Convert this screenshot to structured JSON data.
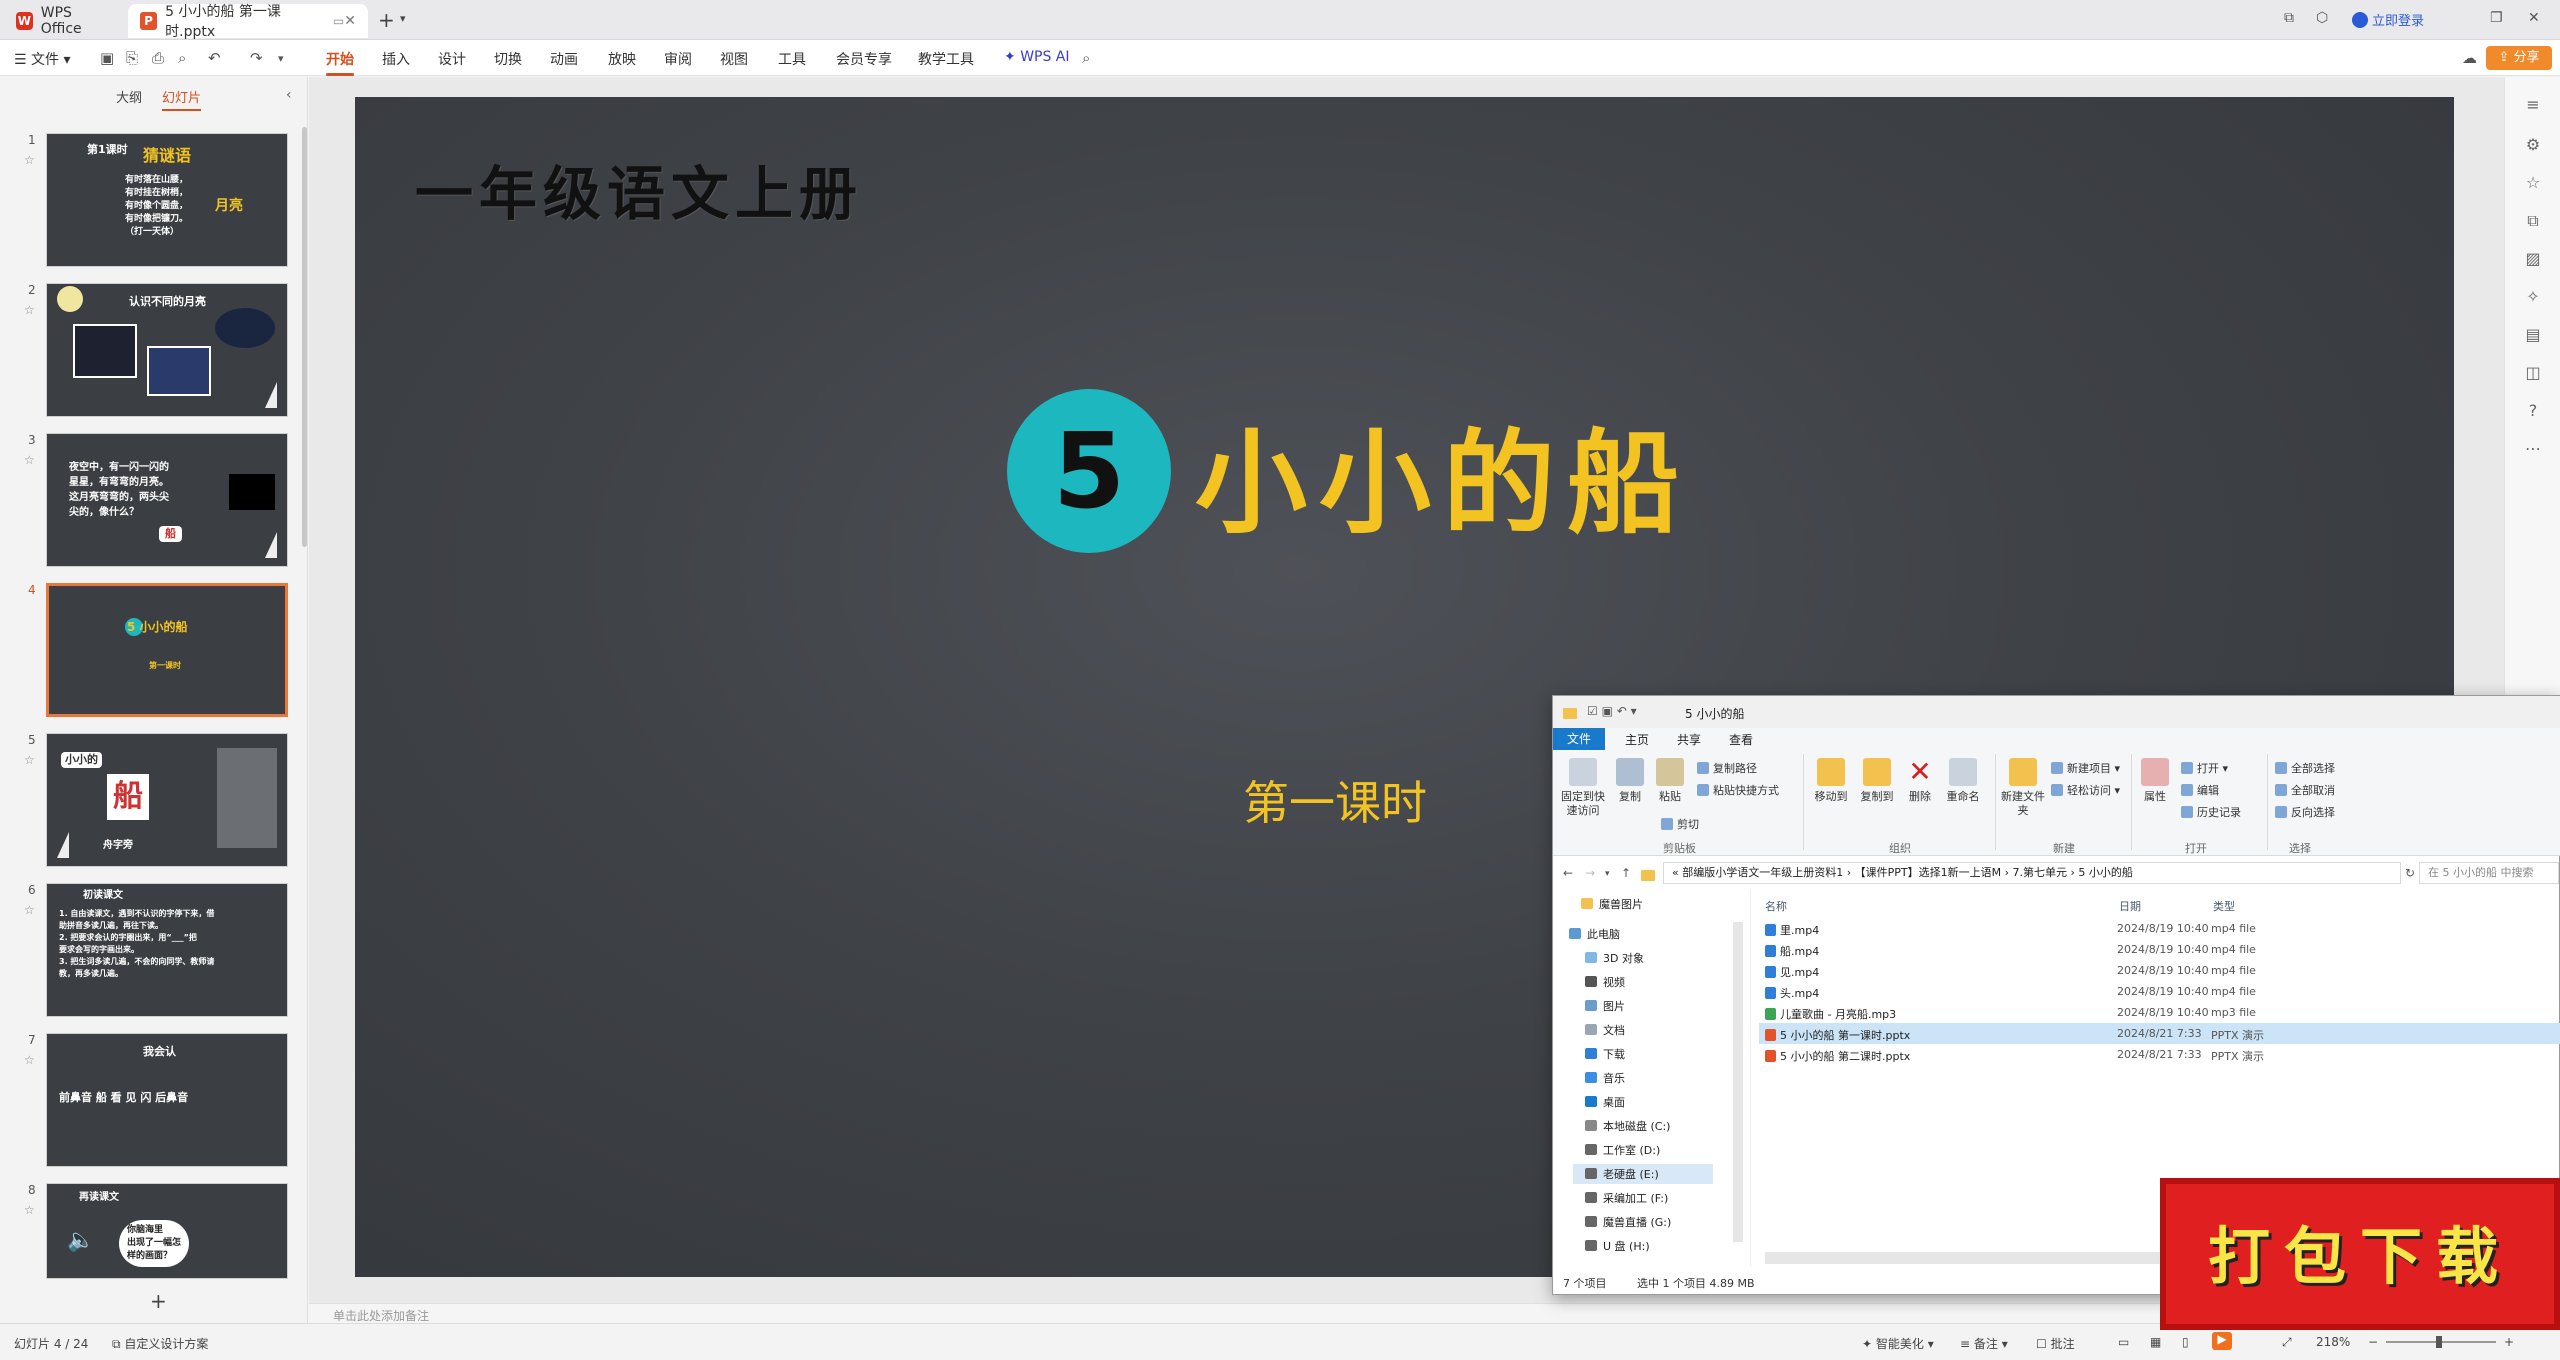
{
  "titlebar": {
    "home_tab": "WPS Office",
    "doc_tab": "5 小小的船 第一课时.pptx",
    "login": "立即登录"
  },
  "menubar": {
    "file": "文件",
    "items": [
      "开始",
      "插入",
      "设计",
      "切换",
      "动画",
      "放映",
      "审阅",
      "视图",
      "工具",
      "会员专享",
      "教学工具"
    ],
    "wps_ai": "WPS AI",
    "share": "分享"
  },
  "left_panel": {
    "tab_outline": "大纲",
    "tab_slides": "幻灯片",
    "slides": [
      {
        "num": "1",
        "text": "第1课时",
        "title": "猜谜语",
        "body": "有时落在山腰，\n有时挂在树梢，\n有时像个圆盘，\n有时像把镰刀。\n（打一天体）",
        "answer": "月亮"
      },
      {
        "num": "2",
        "title": "认识不同的月亮"
      },
      {
        "num": "3",
        "body": "夜空中，有一闪一闪的\n星星，有弯弯的月亮。\n这月亮弯弯的，两头尖\n尖的，像什么？",
        "answer": "船"
      },
      {
        "num": "4",
        "title": "5 小小的船",
        "body": "第一课时"
      },
      {
        "num": "5",
        "text": "小小的",
        "answer": "船",
        "body": "舟字旁"
      },
      {
        "num": "6",
        "title": "初读课文",
        "body": "1. 自由读课文，遇到不认识的字停下来，借\n助拼音多读几遍，再往下读。\n2. 把要求会认的字圈出来，用“___”把\n要求会写的字画出来。\n3. 把生词多读几遍，不会的向同学、教师请\n教，再多读几遍。"
      },
      {
        "num": "7",
        "title": "我会认",
        "body": "前鼻音   船  看  见  闪   后鼻音"
      },
      {
        "num": "8",
        "title": "再读课文",
        "body": "你脑海里\n出现了一幅怎\n样的画面？"
      }
    ]
  },
  "slide": {
    "grade": "一年级语文上册",
    "lesson_num": "5",
    "title": "小小的船",
    "subtitle": "第一课时"
  },
  "notes_placeholder": "单击此处添加备注",
  "statusbar": {
    "slide_count": "幻灯片 4 / 24",
    "design": "自定义设计方案",
    "beautify": "智能美化",
    "notes": "备注",
    "comments": "批注",
    "zoom": "218%"
  },
  "explorer": {
    "title": "5 小小的船",
    "tabs": [
      "文件",
      "主页",
      "共享",
      "查看"
    ],
    "ribbon": {
      "pin": "固定到快速访问",
      "copy": "复制",
      "paste": "粘贴",
      "copy_path": "复制路径",
      "paste_shortcut": "粘贴快捷方式",
      "cut": "剪切",
      "clipboard_group": "剪贴板",
      "move_to": "移动到",
      "copy_to": "复制到",
      "delete": "删除",
      "rename": "重命名",
      "organize_group": "组织",
      "new_folder": "新建文件夹",
      "new_item": "新建项目",
      "easy_access": "轻松访问",
      "new_group": "新建",
      "properties": "属性",
      "open": "打开",
      "edit": "编辑",
      "history": "历史记录",
      "open_group": "打开",
      "select_all": "全部选择",
      "select_none": "全部取消",
      "invert": "反向选择",
      "select_group": "选择"
    },
    "address": "« 部编版小学语文一年级上册资料1 › 【课件PPT】选择1新一上语M › 7.第七单元 › 5 小小的船",
    "search_placeholder": "在 5 小小的船 中搜索",
    "nav": [
      "魔兽图片",
      "此电脑",
      "3D 对象",
      "视频",
      "图片",
      "文档",
      "下载",
      "音乐",
      "桌面",
      "本地磁盘 (C:)",
      "工作室 (D:)",
      "老硬盘 (E:)",
      "采编加工 (F:)",
      "魔兽直播 (G:)",
      "U 盘 (H:)"
    ],
    "columns": {
      "name": "名称",
      "date": "日期",
      "type": "类型"
    },
    "files": [
      {
        "name": "里.mp4",
        "date": "2024/8/19 10:40",
        "type": "mp4 file"
      },
      {
        "name": "船.mp4",
        "date": "2024/8/19 10:40",
        "type": "mp4 file"
      },
      {
        "name": "见.mp4",
        "date": "2024/8/19 10:40",
        "type": "mp4 file"
      },
      {
        "name": "头.mp4",
        "date": "2024/8/19 10:40",
        "type": "mp4 file"
      },
      {
        "name": "儿童歌曲 - 月亮船.mp3",
        "date": "2024/8/19 10:40",
        "type": "mp3 file"
      },
      {
        "name": "5 小小的船 第一课时.pptx",
        "date": "2024/8/21 7:33",
        "type": "PPTX 演示"
      },
      {
        "name": "5 小小的船 第二课时.pptx",
        "date": "2024/8/21 7:33",
        "type": "PPTX 演示"
      }
    ],
    "status_items": "7 个项目",
    "status_selected": "选中 1 个项目 4.89 MB"
  },
  "download_banner": "打包下载",
  "colors": {
    "accent": "#d4501e",
    "slide_title": "#f3c421",
    "circle": "#1db8bf",
    "banner": "#e02020"
  }
}
